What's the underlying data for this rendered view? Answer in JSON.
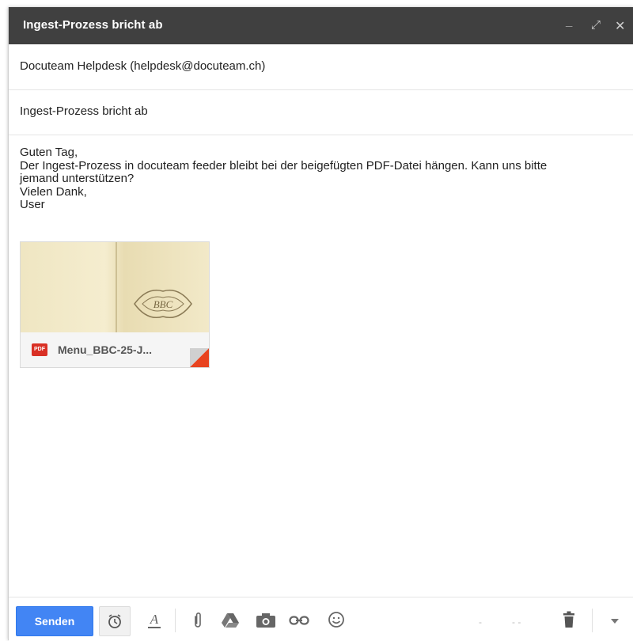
{
  "window": {
    "title": "Ingest-Prozess bricht ab",
    "controls": {
      "minimize": "_",
      "maximize": "⤢",
      "close": "✕"
    }
  },
  "recipient": "Docuteam Helpdesk (helpdesk@docuteam.ch)",
  "subject": "Ingest-Prozess bricht ab",
  "body_lines": [
    "Guten Tag,",
    "Der Ingest-Prozess in docuteam feeder bleibt bei der beigefügten PDF-Datei hängen. Kann uns bitte",
    "jemand unterstützen?",
    "Vielen Dank,",
    "User"
  ],
  "attachment": {
    "filename": "Menu_BBC-25-J...",
    "type_label": "PDF",
    "emblem_text": "BBC"
  },
  "toolbar": {
    "send_label": "Senden",
    "icons": [
      "schedule-send-icon",
      "text-format-icon",
      "attach-icon",
      "drive-icon",
      "photo-icon",
      "link-icon",
      "emoji-icon",
      "discard-icon",
      "more-options-icon"
    ]
  },
  "colors": {
    "titlebar": "#404040",
    "send_button": "#4285f4",
    "pdf_red": "#d93025"
  }
}
